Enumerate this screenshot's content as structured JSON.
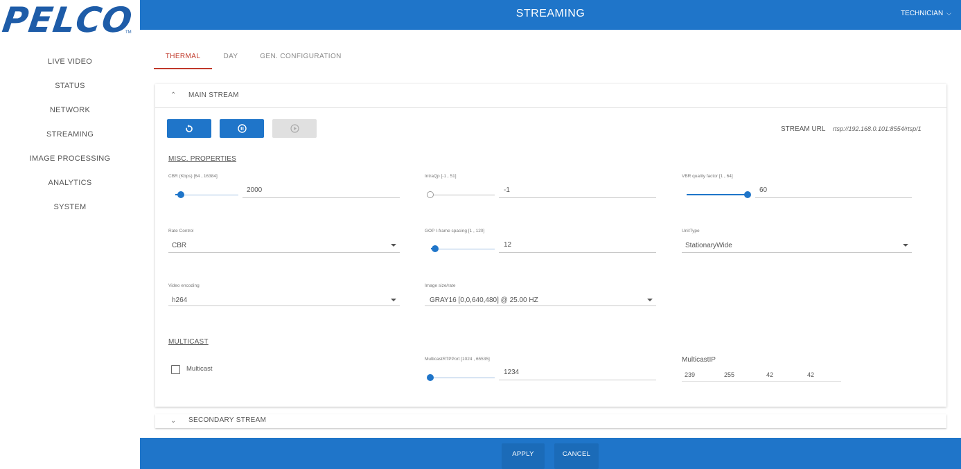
{
  "brand": {
    "logo_text": "PELCO",
    "tm": "TM"
  },
  "nav": [
    {
      "label": "LIVE VIDEO"
    },
    {
      "label": "STATUS"
    },
    {
      "label": "NETWORK"
    },
    {
      "label": "STREAMING"
    },
    {
      "label": "IMAGE PROCESSING"
    },
    {
      "label": "ANALYTICS"
    },
    {
      "label": "SYSTEM"
    }
  ],
  "topbar": {
    "title": "STREAMING",
    "user": "TECHNICIAN"
  },
  "tabs": [
    {
      "label": "THERMAL",
      "active": true
    },
    {
      "label": "DAY",
      "active": false
    },
    {
      "label": "GEN. CONFIGURATION",
      "active": false
    }
  ],
  "main_stream": {
    "title": "MAIN STREAM",
    "buttons": {
      "restart_icon": "restart-icon",
      "stop_icon": "stop-icon",
      "play_icon": "play-icon"
    },
    "stream_url_label": "STREAM URL",
    "stream_url": "rtsp://192.168.0.101:8554/rtsp/1",
    "misc_title": "MISC. PROPERTIES",
    "cbr": {
      "label": "CBR (Kbps) [64 , 16384]",
      "value": "2000",
      "slider_fraction": 0.12
    },
    "intraqp": {
      "label": "IntraQp [-1 , 51]",
      "value": "-1",
      "slider_fraction": 0.0
    },
    "vbr": {
      "label": "VBR quality factor [1 , 64]",
      "value": "60",
      "slider_fraction": 0.94
    },
    "rate_control": {
      "label": "Rate Control",
      "value": "CBR"
    },
    "gop": {
      "label": "GOP I-frame spacing [1 , 120]",
      "value": "12",
      "slider_fraction": 0.1
    },
    "unit_type": {
      "label": "UnitType",
      "value": "StationaryWide"
    },
    "video_encoding": {
      "label": "Video encoding",
      "value": "h264"
    },
    "image_size": {
      "label": "Image size/rate",
      "value": "GRAY16 [0,0,640,480] @ 25.00 HZ"
    },
    "multicast_title": "MULTICAST",
    "multicast_checkbox": {
      "label": "Multicast",
      "checked": false
    },
    "multicast_port": {
      "label": "MulticastRTPPort [1024 , 65535]",
      "value": "1234",
      "slider_fraction": 0.0
    },
    "multicast_ip": {
      "label": "MulticastIP",
      "octets": [
        "239",
        "255",
        "42",
        "42"
      ]
    }
  },
  "secondary_stream": {
    "title": "SECONDARY STREAM"
  },
  "footer": {
    "apply": "APPLY",
    "cancel": "CANCEL"
  },
  "colors": {
    "primary": "#1f75c9",
    "tab_active": "#c0392b"
  }
}
